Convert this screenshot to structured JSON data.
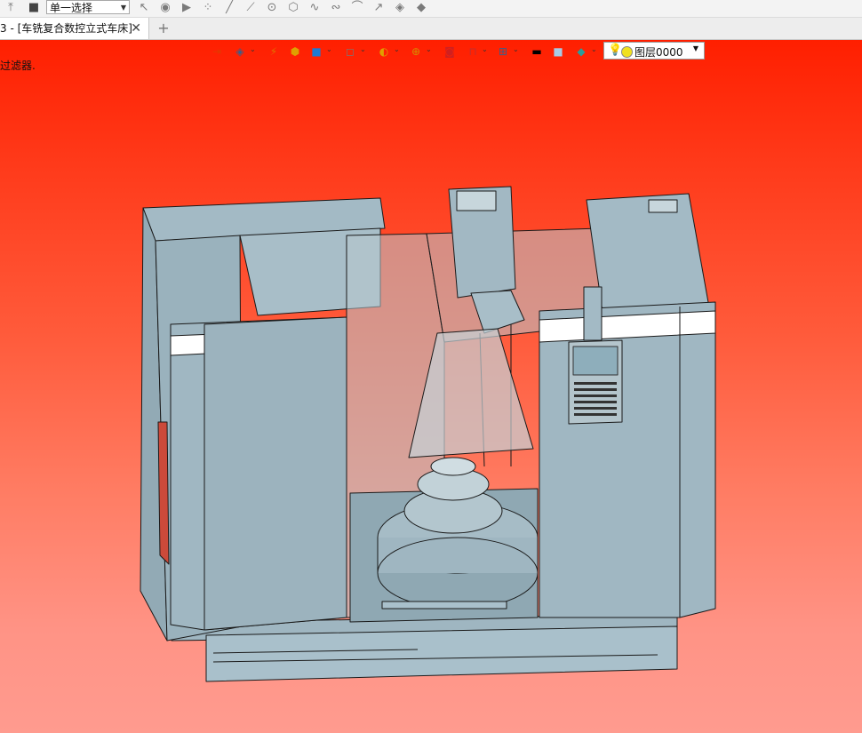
{
  "toolbar": {
    "select_mode": "单一选择",
    "icons": [
      "help-icon",
      "stop-icon",
      "select-arrow-icon",
      "select-face-icon",
      "play-icon",
      "points-icon",
      "line-icon",
      "line2-icon",
      "circle-icon",
      "polygon-icon",
      "spline-icon",
      "curve-icon",
      "arc-icon",
      "vector-icon",
      "cad-icon",
      "layers-icon"
    ]
  },
  "tabs": {
    "document_label": "3 - [车铣复合数控立式车床]",
    "close_glyph": "✕",
    "new_glyph": "+"
  },
  "viewport": {
    "filter_label": "过滤器.",
    "layer_name": "图层0000",
    "background_top": "#ff1f00",
    "background_bottom": "#ff9b8f",
    "model_color": "#9fb6c1"
  }
}
